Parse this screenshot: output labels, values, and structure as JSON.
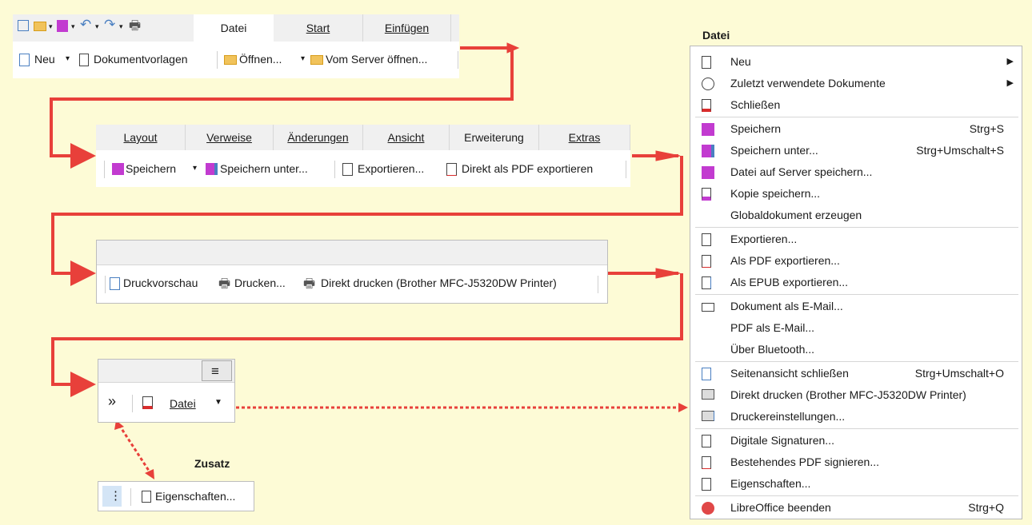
{
  "colors": {
    "background": "#fdfbd6",
    "arrow": "#e8403a",
    "purple": "#8a2be2",
    "red": "#d92c2c"
  },
  "toolbar1": {
    "tabs": [
      "Datei",
      "Start",
      "Einfügen"
    ],
    "new_label": "Neu",
    "templates_label": "Dokumentvorlagen",
    "open_label": "Öffnen...",
    "open_remote_label": "Vom Server öffnen..."
  },
  "toolbar2": {
    "tabs": [
      "Layout",
      "Verweise",
      "Änderungen",
      "Ansicht",
      "Erweiterung",
      "Extras"
    ],
    "save_label": "Speichern",
    "save_as_label": "Speichern unter...",
    "export_label": "Exportieren...",
    "export_pdf_label": "Direkt als PDF exportieren"
  },
  "toolbar3": {
    "preview_label": "Druckvorschau",
    "print_label": "Drucken...",
    "direct_print_label": "Direkt drucken (Brother MFC-J5320DW Printer)"
  },
  "toolbar4": {
    "more_label": "»",
    "file_label": "Datei"
  },
  "zusatz": {
    "title": "Zusatz",
    "properties_label": "Eigenschaften..."
  },
  "menu": {
    "title": "Datei",
    "items": [
      {
        "label": "Neu",
        "shortcut": "",
        "submenu": true,
        "icon": "new-doc-icon"
      },
      {
        "label": "Zuletzt verwendete Dokumente",
        "shortcut": "",
        "submenu": true,
        "icon": "recent-icon"
      },
      {
        "label": "Schließen",
        "shortcut": "",
        "submenu": false,
        "icon": "close-doc-icon"
      },
      {
        "label": "Speichern",
        "shortcut": "Strg+S",
        "submenu": false,
        "icon": "save-icon"
      },
      {
        "label": "Speichern unter...",
        "shortcut": "Strg+Umschalt+S",
        "submenu": false,
        "icon": "save-as-icon"
      },
      {
        "label": "Datei auf Server speichern...",
        "shortcut": "",
        "submenu": false,
        "icon": "save-remote-icon"
      },
      {
        "label": "Kopie speichern...",
        "shortcut": "",
        "submenu": false,
        "icon": "save-copy-icon"
      },
      {
        "label": "Globaldokument erzeugen",
        "shortcut": "",
        "submenu": false,
        "icon": ""
      },
      {
        "label": "Exportieren...",
        "shortcut": "",
        "submenu": false,
        "icon": "export-icon"
      },
      {
        "label": "Als PDF exportieren...",
        "shortcut": "",
        "submenu": false,
        "icon": "pdf-icon"
      },
      {
        "label": "Als EPUB exportieren...",
        "shortcut": "",
        "submenu": false,
        "icon": "epub-icon"
      },
      {
        "label": "Dokument als E-Mail...",
        "shortcut": "",
        "submenu": false,
        "icon": "mail-icon"
      },
      {
        "label": "PDF als E-Mail...",
        "shortcut": "",
        "submenu": false,
        "icon": ""
      },
      {
        "label": "Über Bluetooth...",
        "shortcut": "",
        "submenu": false,
        "icon": ""
      },
      {
        "label": "Seitenansicht schließen",
        "shortcut": "Strg+Umschalt+O",
        "submenu": false,
        "icon": "preview-icon"
      },
      {
        "label": "Direkt drucken (Brother MFC-J5320DW Printer)",
        "shortcut": "",
        "submenu": false,
        "icon": "direct-print-icon"
      },
      {
        "label": "Druckereinstellungen...",
        "shortcut": "",
        "submenu": false,
        "icon": "printer-settings-icon"
      },
      {
        "label": "Digitale Signaturen...",
        "shortcut": "",
        "submenu": false,
        "icon": "signature-icon"
      },
      {
        "label": "Bestehendes PDF signieren...",
        "shortcut": "",
        "submenu": false,
        "icon": "sign-pdf-icon"
      },
      {
        "label": "Eigenschaften...",
        "shortcut": "",
        "submenu": false,
        "icon": "properties-icon"
      },
      {
        "label": "LibreOffice beenden",
        "shortcut": "Strg+Q",
        "submenu": false,
        "icon": "power-icon"
      }
    ]
  }
}
